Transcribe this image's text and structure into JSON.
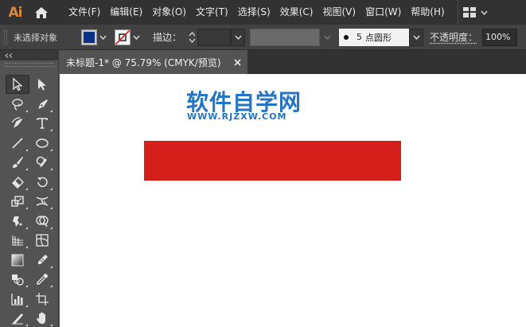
{
  "app": {
    "logo_text": "Ai"
  },
  "menu": [
    {
      "label": "文件(F)"
    },
    {
      "label": "编辑(E)"
    },
    {
      "label": "对象(O)"
    },
    {
      "label": "文字(T)"
    },
    {
      "label": "选择(S)"
    },
    {
      "label": "效果(C)"
    },
    {
      "label": "视图(V)"
    },
    {
      "label": "窗口(W)"
    },
    {
      "label": "帮助(H)"
    }
  ],
  "control": {
    "selection_status": "未选择对象",
    "fill_color": "#0b3088",
    "stroke_label": "描边：",
    "brush_size": "5",
    "brush_name": "点圆形",
    "opacity_label": "不透明度：",
    "opacity_value": "100%"
  },
  "document": {
    "tab_title": "未标题-1* @ 75.79% (CMYK/预览)",
    "canvas": {
      "watermark_title": "软件自学网",
      "watermark_url": "WWW.RJZXW.COM",
      "rectangle_color": "#d52019"
    }
  },
  "tools": [
    {
      "name": "selection-tool-icon"
    },
    {
      "name": "direct-selection-tool-icon"
    },
    {
      "name": "lasso-tool-icon"
    },
    {
      "name": "pen-tool-icon"
    },
    {
      "name": "curvature-tool-icon"
    },
    {
      "name": "type-tool-icon"
    },
    {
      "name": "line-tool-icon"
    },
    {
      "name": "ellipse-tool-icon"
    },
    {
      "name": "paintbrush-tool-icon"
    },
    {
      "name": "shaper-tool-icon"
    },
    {
      "name": "eraser-tool-icon"
    },
    {
      "name": "rotate-tool-icon"
    },
    {
      "name": "scale-tool-icon"
    },
    {
      "name": "width-tool-icon"
    },
    {
      "name": "puppet-warp-tool-icon"
    },
    {
      "name": "shape-builder-tool-icon"
    },
    {
      "name": "perspective-grid-tool-icon"
    },
    {
      "name": "mesh-tool-icon"
    },
    {
      "name": "gradient-tool-icon"
    },
    {
      "name": "eyedropper-alt-tool-icon"
    },
    {
      "name": "blend-tool-icon"
    },
    {
      "name": "eyedropper-tool-icon"
    },
    {
      "name": "graph-tool-icon"
    },
    {
      "name": "artboard-tool-icon"
    },
    {
      "name": "slice-tool-icon"
    },
    {
      "name": "hand-tool-icon"
    }
  ]
}
